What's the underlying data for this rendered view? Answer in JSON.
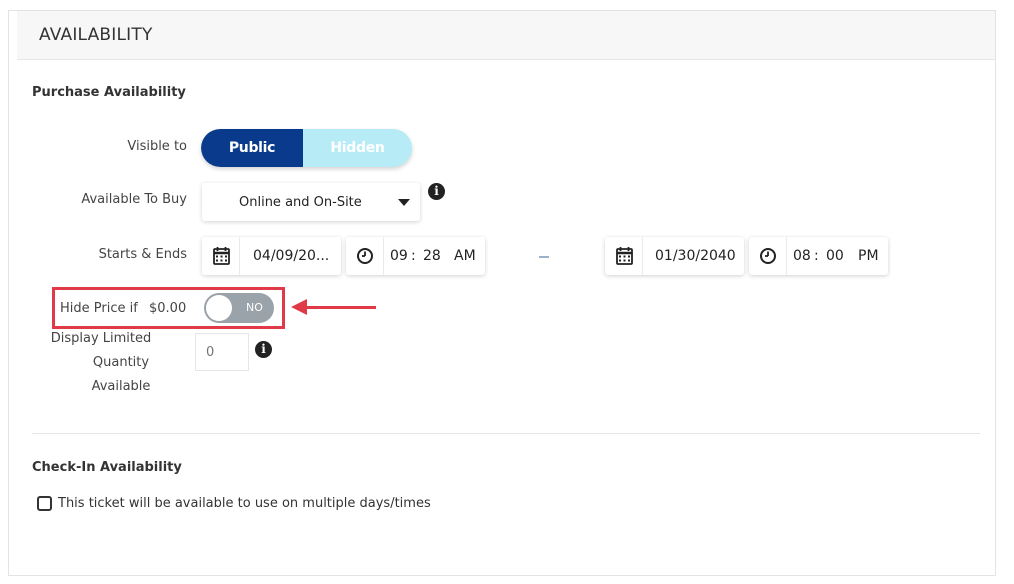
{
  "panel": {
    "title": "AVAILABILITY"
  },
  "purchase": {
    "section_title": "Purchase Availability",
    "visible_to": {
      "label": "Visible to",
      "options": [
        "Public",
        "Hidden"
      ],
      "selected": "Public"
    },
    "available_to_buy": {
      "label": "Available To Buy",
      "value": "Online and On-Site"
    },
    "starts_ends": {
      "label": "Starts & Ends",
      "start_date": "04/09/20...",
      "start_time": {
        "hour": "09",
        "minute": "28",
        "ampm": "AM"
      },
      "separator": ":",
      "end_date": "01/30/2040",
      "end_time": {
        "hour": "08",
        "minute": "00",
        "ampm": "PM"
      }
    },
    "hide_price": {
      "label": "Hide Price if",
      "amount": "$0.00",
      "toggle_text": "NO"
    },
    "display_limited": {
      "label_line1": "Display Limited",
      "label_line2": "Quantity",
      "label_line3": "Available",
      "placeholder": "0"
    }
  },
  "checkin": {
    "section_title": "Check-In Availability",
    "multiple_days_label": "This ticket will be available to use on multiple days/times"
  },
  "icons": {
    "info": "i",
    "calendar": "calendar-icon",
    "clock": "clock-icon"
  },
  "colors": {
    "primary": "#0a3a8c",
    "secondary": "#b7ecf6",
    "highlight": "#e03a48",
    "toggle_off": "#9aa2aa"
  }
}
